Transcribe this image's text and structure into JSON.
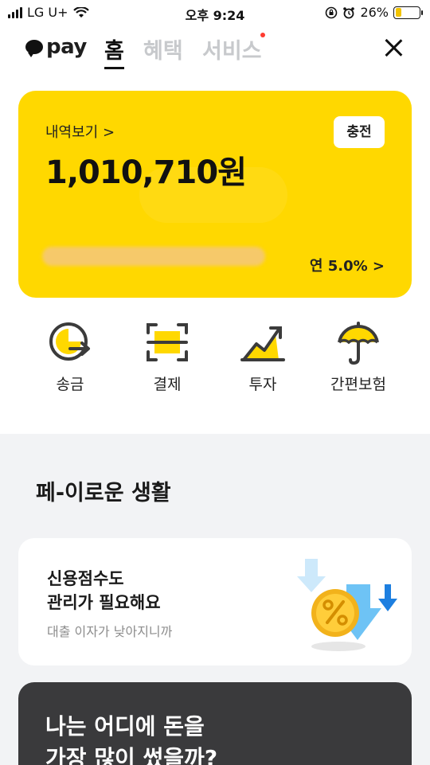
{
  "status": {
    "carrier": "LG U+",
    "time": "오후 9:24",
    "battery": "26%",
    "battery_level": 0.26
  },
  "nav": {
    "logo": "pay",
    "tabs": [
      "홈",
      "혜택",
      "서비스"
    ],
    "active_tab": 0
  },
  "card": {
    "history_link": "내역보기 >",
    "balance": "1,010,710원",
    "charge_button": "충전",
    "rate": "연 5.0% >"
  },
  "actions": [
    {
      "label": "송금",
      "icon": "send-money-icon"
    },
    {
      "label": "결제",
      "icon": "scan-pay-icon"
    },
    {
      "label": "투자",
      "icon": "invest-chart-icon"
    },
    {
      "label": "간편보험",
      "icon": "umbrella-icon"
    }
  ],
  "section": {
    "title": "페-이로운 생활"
  },
  "credit_card": {
    "title": "신용점수도 관리가 필요해요",
    "subtitle": "대출 이자가 낮아지니까"
  },
  "dark_card": {
    "title": "나는 어디에 돈을 가장 많이 썼을까?"
  },
  "colors": {
    "accent": "#ffd800",
    "background": "#ffffff",
    "section": "#f2f3f5",
    "dark": "#3a3a3c"
  }
}
